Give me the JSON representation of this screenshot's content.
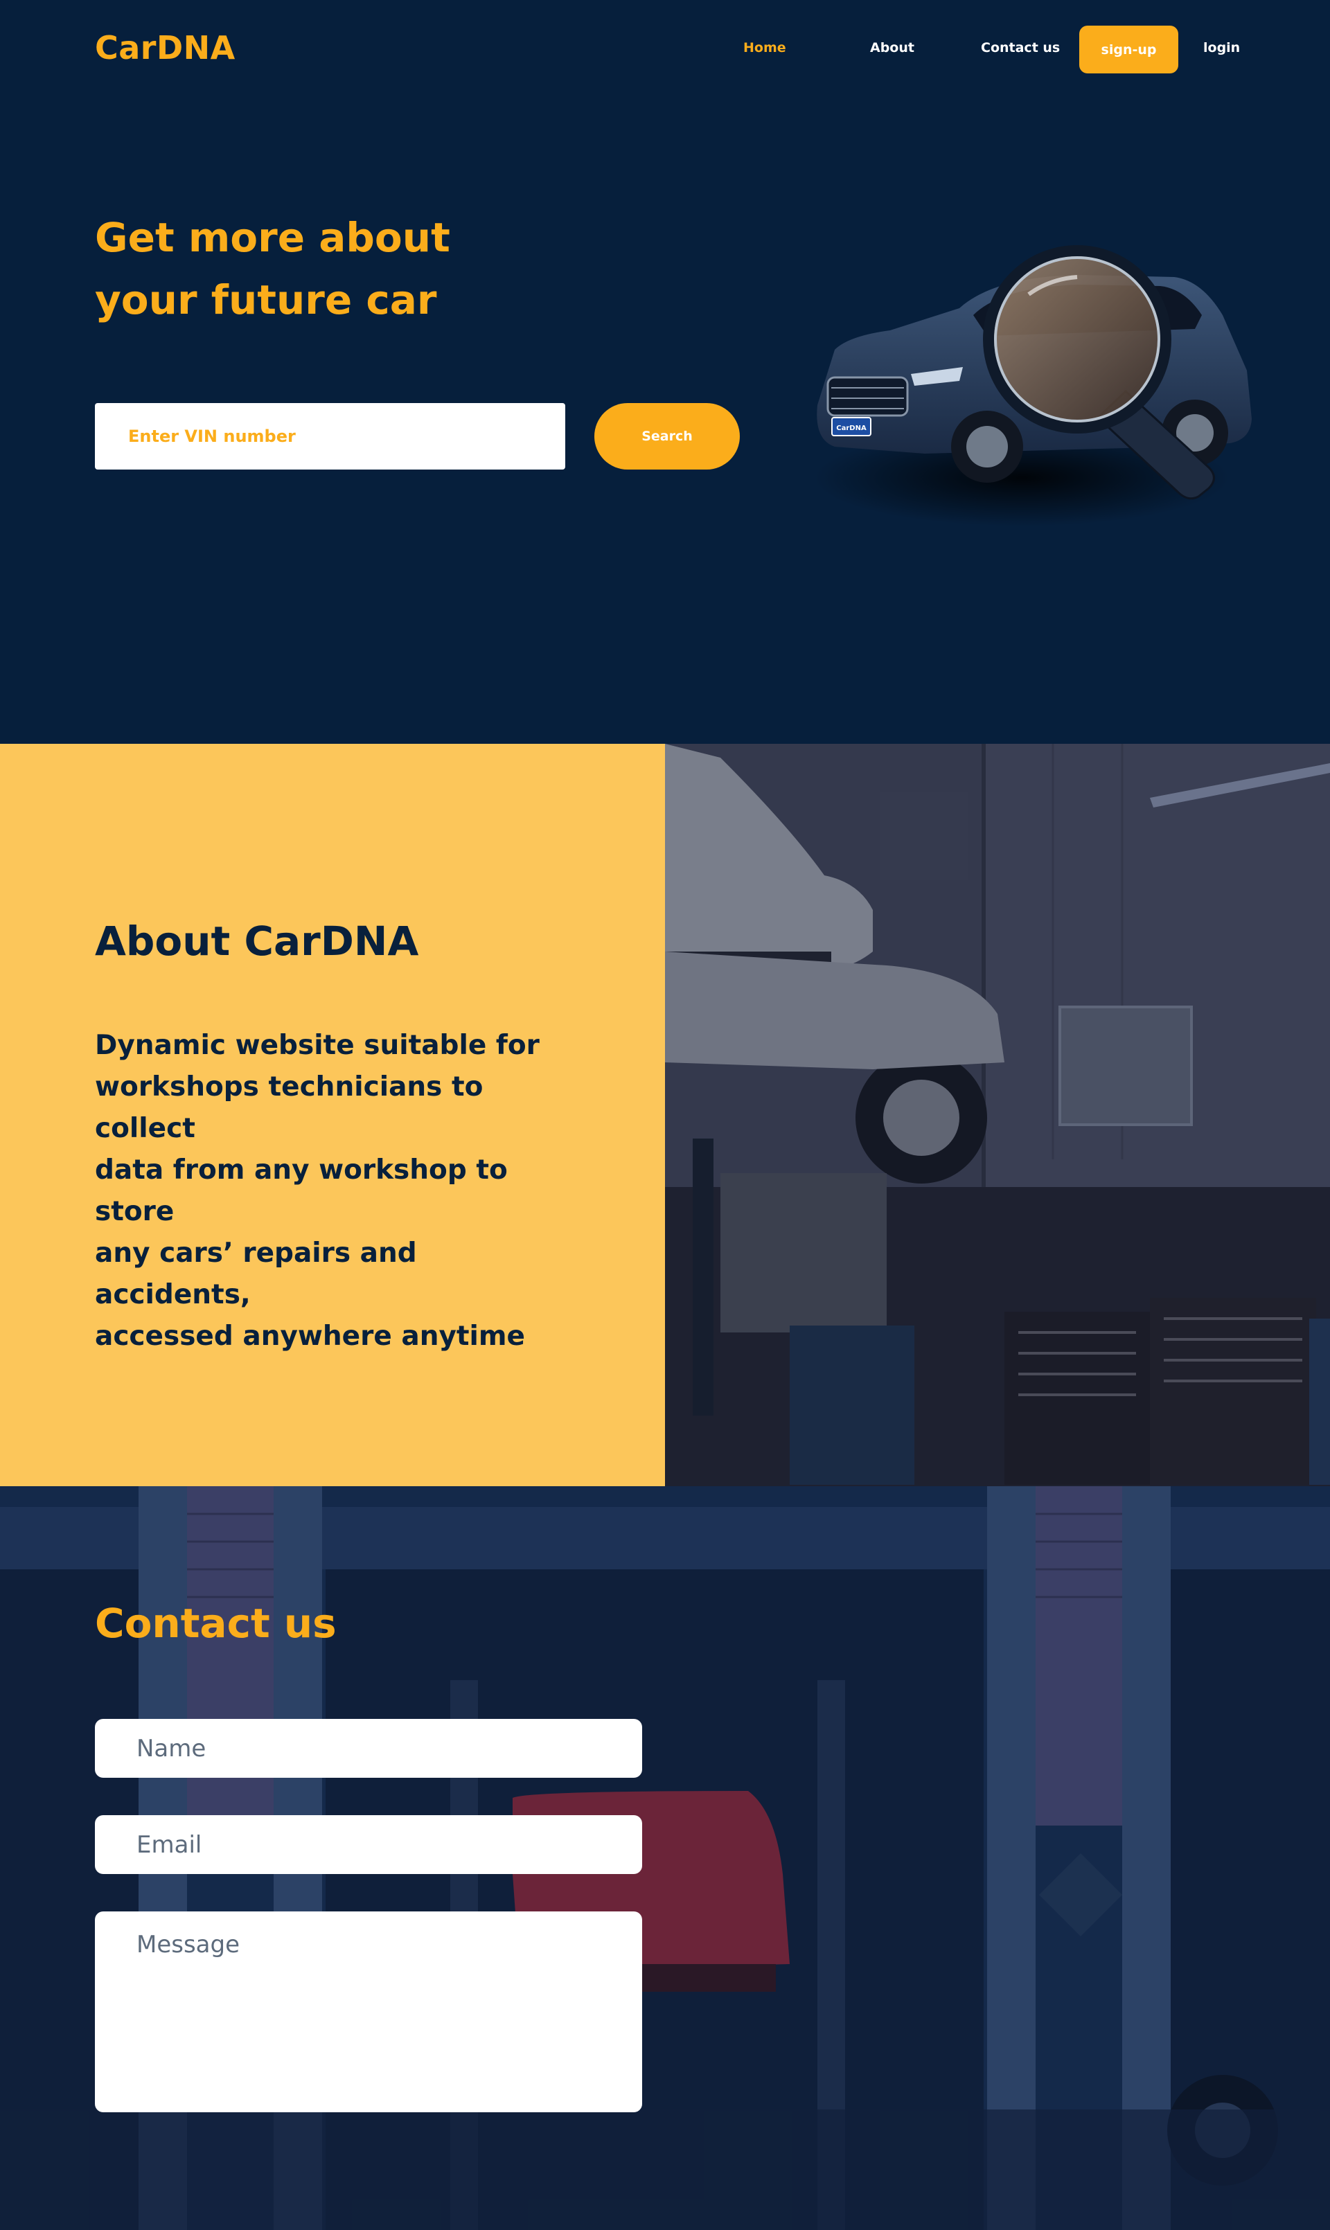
{
  "brand": {
    "name": "CarDNA",
    "accent_color": "#fbad1b",
    "navy_color": "#061f3c",
    "about_bg_color": "#fcc65a"
  },
  "nav": {
    "items": [
      {
        "label": "Home",
        "active": true
      },
      {
        "label": "About",
        "active": false
      },
      {
        "label": "Contact us",
        "active": false
      }
    ],
    "signup_label": "sign-up",
    "login_label": "login"
  },
  "hero": {
    "title_line1": "Get more about",
    "title_line2": "your future car",
    "vin_placeholder": "Enter VIN number",
    "search_label": "Search",
    "car_badge": "CarDNA"
  },
  "about": {
    "title": "About CarDNA",
    "text_lines": [
      "Dynamic website suitable for",
      "workshops technicians to collect",
      "data from any workshop to store",
      "any cars’ repairs and accidents,",
      "accessed anywhere anytime"
    ]
  },
  "contact": {
    "title": "Contact us",
    "name_placeholder": "Name",
    "email_placeholder": "Email",
    "message_placeholder": "Message"
  }
}
